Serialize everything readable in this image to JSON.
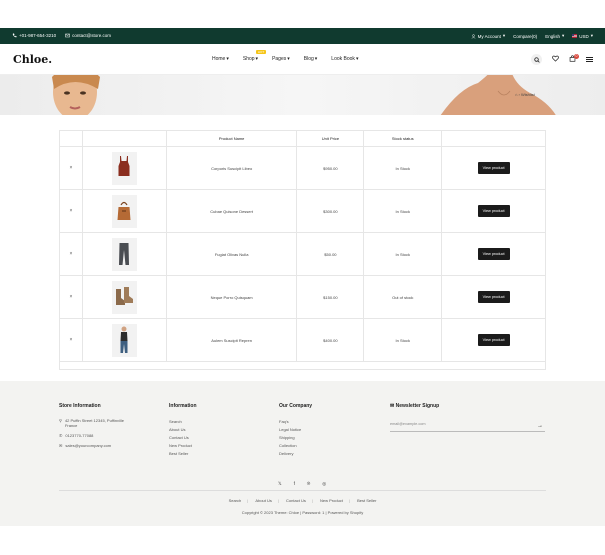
{
  "topbar": {
    "phone": "+01-987-654-3210",
    "email": "contact@store.com",
    "account": "My Account",
    "compare": "Compare(0)",
    "language": "English",
    "currency": "USD"
  },
  "header": {
    "logo": "Chloe.",
    "nav": [
      {
        "label": "Home"
      },
      {
        "label": "Shop",
        "badge": "HOT"
      },
      {
        "label": "Pages"
      },
      {
        "label": "Blog"
      },
      {
        "label": "Look Book"
      }
    ],
    "cart_count": "0"
  },
  "banner": {
    "breadcrumb_home_icon": "home-icon",
    "breadcrumb_current": "Wishlist"
  },
  "table": {
    "headers": [
      "",
      "",
      "Product Name",
      "Unit Price",
      "Stock status",
      ""
    ],
    "rows": [
      {
        "name": "Corporis Suscipit Libeo",
        "price": "$950.00",
        "stock": "In Stock",
        "stock_status": "in",
        "button": "View product",
        "thumb": "top"
      },
      {
        "name": "Cubae Quisone Dessert",
        "price": "$300.00",
        "stock": "In Stock",
        "stock_status": "in",
        "button": "View product",
        "thumb": "bag"
      },
      {
        "name": "Fugiat Olivas Nulla",
        "price": "$50.00",
        "stock": "In Stock",
        "stock_status": "in",
        "button": "View product",
        "thumb": "pants"
      },
      {
        "name": "Neque Porro Quisquam",
        "price": "$150.00",
        "stock": "Out of stock",
        "stock_status": "out",
        "button": "View product",
        "thumb": "boots"
      },
      {
        "name": "Aulem Suscipit Repren",
        "price": "$400.00",
        "stock": "In Stock",
        "stock_status": "in",
        "button": "View product",
        "thumb": "model"
      }
    ]
  },
  "footer": {
    "store": {
      "title": "Store Information",
      "address": "42 Puffin Street 12345, Puffinville France",
      "phone": "0123770-77088",
      "email": "sales@yourcompany.com"
    },
    "information": {
      "title": "Information",
      "links": [
        "Search",
        "About Us",
        "Contact Us",
        "New Product",
        "Best Seller"
      ]
    },
    "company": {
      "title": "Our Company",
      "links": [
        "Faq's",
        "Legal Notice",
        "Shipping",
        "Collection",
        "Delivery"
      ]
    },
    "newsletter": {
      "title": "Newsletter Signup",
      "placeholder": "email@example.com"
    },
    "bottom_links": [
      "Search",
      "About Us",
      "Contact Us",
      "New Product",
      "Best Seller"
    ],
    "copyright": "Copyright © 2023 Theme: Chloe | Password: 1 | Powered by Shopify"
  },
  "colors": {
    "topbar_bg": "#103a2f",
    "price": "#c0392b",
    "in_stock": "#2bb673",
    "out_of_stock": "#d9473c",
    "button_bg": "#1b1b1b"
  }
}
